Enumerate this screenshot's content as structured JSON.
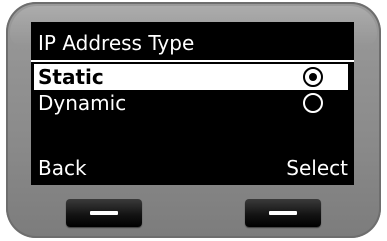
{
  "screen": {
    "title": "IP Address Type",
    "options": [
      {
        "label": "Static",
        "selected": true,
        "icon": "radio-selected-icon"
      },
      {
        "label": "Dynamic",
        "selected": false,
        "icon": "radio-unselected-icon"
      }
    ]
  },
  "softkeys": {
    "left_label": "Back",
    "right_label": "Select"
  },
  "colors": {
    "screen_background": "#000000",
    "screen_text": "#ffffff",
    "highlight_background": "#ffffff",
    "highlight_text": "#000000",
    "bezel": "#8f8f8f"
  }
}
